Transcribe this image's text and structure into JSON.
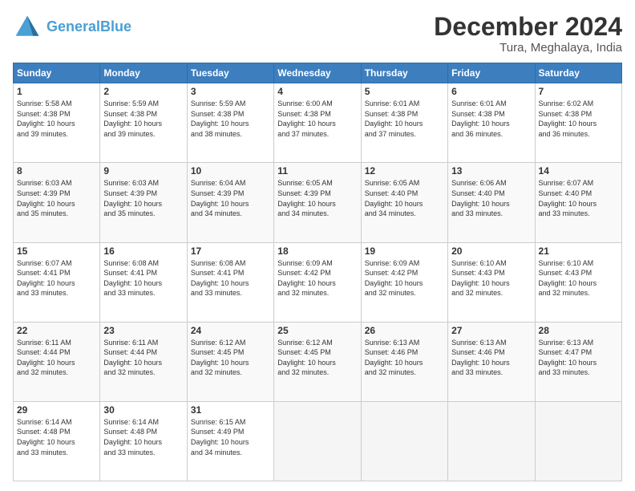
{
  "header": {
    "logo_text_general": "General",
    "logo_text_blue": "Blue",
    "main_title": "December 2024",
    "subtitle": "Tura, Meghalaya, India"
  },
  "calendar": {
    "days_of_week": [
      "Sunday",
      "Monday",
      "Tuesday",
      "Wednesday",
      "Thursday",
      "Friday",
      "Saturday"
    ],
    "weeks": [
      [
        {
          "day": "1",
          "info": "Sunrise: 5:58 AM\nSunset: 4:38 PM\nDaylight: 10 hours\nand 39 minutes."
        },
        {
          "day": "2",
          "info": "Sunrise: 5:59 AM\nSunset: 4:38 PM\nDaylight: 10 hours\nand 39 minutes."
        },
        {
          "day": "3",
          "info": "Sunrise: 5:59 AM\nSunset: 4:38 PM\nDaylight: 10 hours\nand 38 minutes."
        },
        {
          "day": "4",
          "info": "Sunrise: 6:00 AM\nSunset: 4:38 PM\nDaylight: 10 hours\nand 37 minutes."
        },
        {
          "day": "5",
          "info": "Sunrise: 6:01 AM\nSunset: 4:38 PM\nDaylight: 10 hours\nand 37 minutes."
        },
        {
          "day": "6",
          "info": "Sunrise: 6:01 AM\nSunset: 4:38 PM\nDaylight: 10 hours\nand 36 minutes."
        },
        {
          "day": "7",
          "info": "Sunrise: 6:02 AM\nSunset: 4:38 PM\nDaylight: 10 hours\nand 36 minutes."
        }
      ],
      [
        {
          "day": "8",
          "info": "Sunrise: 6:03 AM\nSunset: 4:39 PM\nDaylight: 10 hours\nand 35 minutes."
        },
        {
          "day": "9",
          "info": "Sunrise: 6:03 AM\nSunset: 4:39 PM\nDaylight: 10 hours\nand 35 minutes."
        },
        {
          "day": "10",
          "info": "Sunrise: 6:04 AM\nSunset: 4:39 PM\nDaylight: 10 hours\nand 34 minutes."
        },
        {
          "day": "11",
          "info": "Sunrise: 6:05 AM\nSunset: 4:39 PM\nDaylight: 10 hours\nand 34 minutes."
        },
        {
          "day": "12",
          "info": "Sunrise: 6:05 AM\nSunset: 4:40 PM\nDaylight: 10 hours\nand 34 minutes."
        },
        {
          "day": "13",
          "info": "Sunrise: 6:06 AM\nSunset: 4:40 PM\nDaylight: 10 hours\nand 33 minutes."
        },
        {
          "day": "14",
          "info": "Sunrise: 6:07 AM\nSunset: 4:40 PM\nDaylight: 10 hours\nand 33 minutes."
        }
      ],
      [
        {
          "day": "15",
          "info": "Sunrise: 6:07 AM\nSunset: 4:41 PM\nDaylight: 10 hours\nand 33 minutes."
        },
        {
          "day": "16",
          "info": "Sunrise: 6:08 AM\nSunset: 4:41 PM\nDaylight: 10 hours\nand 33 minutes."
        },
        {
          "day": "17",
          "info": "Sunrise: 6:08 AM\nSunset: 4:41 PM\nDaylight: 10 hours\nand 33 minutes."
        },
        {
          "day": "18",
          "info": "Sunrise: 6:09 AM\nSunset: 4:42 PM\nDaylight: 10 hours\nand 32 minutes."
        },
        {
          "day": "19",
          "info": "Sunrise: 6:09 AM\nSunset: 4:42 PM\nDaylight: 10 hours\nand 32 minutes."
        },
        {
          "day": "20",
          "info": "Sunrise: 6:10 AM\nSunset: 4:43 PM\nDaylight: 10 hours\nand 32 minutes."
        },
        {
          "day": "21",
          "info": "Sunrise: 6:10 AM\nSunset: 4:43 PM\nDaylight: 10 hours\nand 32 minutes."
        }
      ],
      [
        {
          "day": "22",
          "info": "Sunrise: 6:11 AM\nSunset: 4:44 PM\nDaylight: 10 hours\nand 32 minutes."
        },
        {
          "day": "23",
          "info": "Sunrise: 6:11 AM\nSunset: 4:44 PM\nDaylight: 10 hours\nand 32 minutes."
        },
        {
          "day": "24",
          "info": "Sunrise: 6:12 AM\nSunset: 4:45 PM\nDaylight: 10 hours\nand 32 minutes."
        },
        {
          "day": "25",
          "info": "Sunrise: 6:12 AM\nSunset: 4:45 PM\nDaylight: 10 hours\nand 32 minutes."
        },
        {
          "day": "26",
          "info": "Sunrise: 6:13 AM\nSunset: 4:46 PM\nDaylight: 10 hours\nand 32 minutes."
        },
        {
          "day": "27",
          "info": "Sunrise: 6:13 AM\nSunset: 4:46 PM\nDaylight: 10 hours\nand 33 minutes."
        },
        {
          "day": "28",
          "info": "Sunrise: 6:13 AM\nSunset: 4:47 PM\nDaylight: 10 hours\nand 33 minutes."
        }
      ],
      [
        {
          "day": "29",
          "info": "Sunrise: 6:14 AM\nSunset: 4:48 PM\nDaylight: 10 hours\nand 33 minutes."
        },
        {
          "day": "30",
          "info": "Sunrise: 6:14 AM\nSunset: 4:48 PM\nDaylight: 10 hours\nand 33 minutes."
        },
        {
          "day": "31",
          "info": "Sunrise: 6:15 AM\nSunset: 4:49 PM\nDaylight: 10 hours\nand 34 minutes."
        },
        {
          "day": "",
          "info": ""
        },
        {
          "day": "",
          "info": ""
        },
        {
          "day": "",
          "info": ""
        },
        {
          "day": "",
          "info": ""
        }
      ]
    ]
  }
}
